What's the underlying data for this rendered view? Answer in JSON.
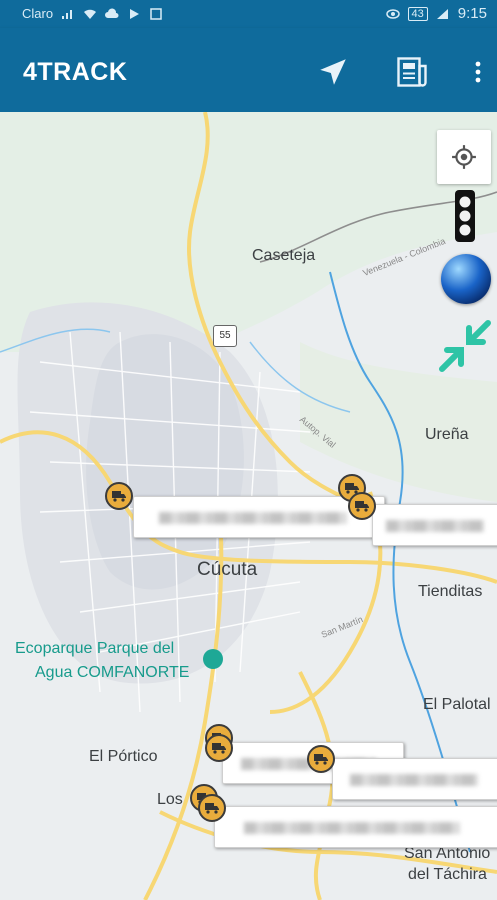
{
  "status_bar": {
    "carrier": "Claro",
    "battery": "43",
    "time": "9:15"
  },
  "app_bar": {
    "title": "4TRACK",
    "icons": [
      "navigation-arrow-icon",
      "report-icon",
      "more-vert-icon"
    ]
  },
  "map": {
    "labels": {
      "caseteja": "Caseteja",
      "highway": "55",
      "urena": "Ureña",
      "cucuta": "Cúcuta",
      "tienditas": "Tienditas",
      "san_martin": "San Martín",
      "ecoparque_1": "Ecoparque Parque del",
      "ecoparque_2": "Agua COMFANORTE",
      "el_palotal": "El Palotal",
      "el_portico": "El Pórtico",
      "los": "Los",
      "san_antonio_1": "San Antonio",
      "san_antonio_2": "del Táchira",
      "autopista": "Autop. Vial",
      "venezuela": "Venezuela - Colombia"
    },
    "controls": [
      "my-location-icon",
      "traffic-light-icon",
      "globe-icon",
      "collapse-icon"
    ]
  },
  "colors": {
    "primary": "#0f6b9c",
    "truck": "#e9ac3c",
    "accent": "#2ec4a6"
  }
}
